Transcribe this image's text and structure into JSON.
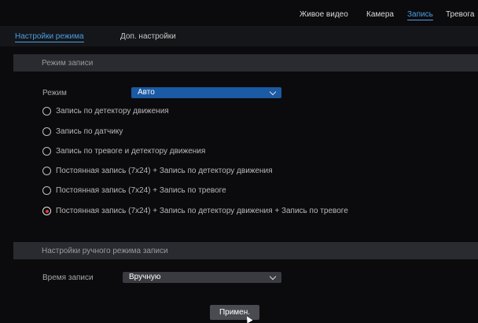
{
  "topnav": {
    "items": [
      {
        "label": "Живое видео"
      },
      {
        "label": "Камера"
      },
      {
        "label": "Запись",
        "active": true
      },
      {
        "label": "Тревога"
      }
    ]
  },
  "subnav": {
    "tabs": [
      {
        "label": "Настройки режима",
        "active": true
      },
      {
        "label": "Доп. настройки"
      }
    ]
  },
  "record_mode": {
    "header": "Режим записи",
    "mode_label": "Режим",
    "mode_value": "Авто",
    "options": [
      {
        "label": "Запись по детектору движения",
        "selected": false
      },
      {
        "label": "Запись по датчику",
        "selected": false
      },
      {
        "label": "Запись по тревоге и детектору движения",
        "selected": false
      },
      {
        "label": "Постоянная запись (7x24) + Запись по детектору движения",
        "selected": false
      },
      {
        "label": "Постоянная запись (7x24) + Запись по тревоге",
        "selected": false
      },
      {
        "label": "Постоянная запись (7x24) + Запись по детектору движения + Запись по тревоге",
        "selected": true
      }
    ]
  },
  "manual_mode": {
    "header": "Настройки ручного режима записи",
    "time_label": "Время записи",
    "time_value": "Вручную"
  },
  "apply_label": "Примен.",
  "colors": {
    "accent": "#4a9fe6",
    "select_primary": "#1b5aa4",
    "radio_selected": "#e53935"
  }
}
